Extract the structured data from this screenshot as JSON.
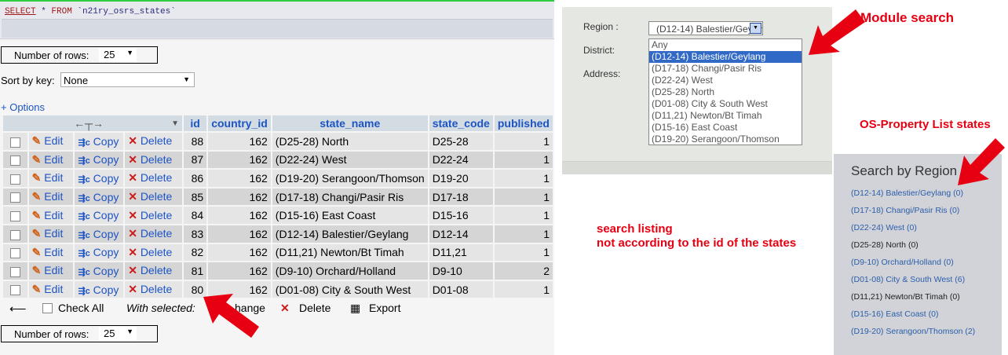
{
  "sql": {
    "kw1": "SELECT",
    "rest1": " * ",
    "kw2": "FROM",
    "rest2": " `n21ry_osrs_states`"
  },
  "num_rows_label": "Number of rows:",
  "num_rows_value": "25",
  "sort_label": "Sort by key:",
  "sort_value": "None",
  "options_link": "+ Options",
  "table": {
    "headers": {
      "id": "id",
      "country_id": "country_id",
      "state_name": "state_name",
      "state_code": "state_code",
      "published": "published"
    },
    "actions": {
      "edit": "Edit",
      "copy": "Copy",
      "delete": "Delete"
    },
    "rows": [
      {
        "id": "88",
        "country_id": "162",
        "state_name": "(D25-28) North",
        "state_code": "D25-28",
        "published": "1"
      },
      {
        "id": "87",
        "country_id": "162",
        "state_name": "(D22-24) West",
        "state_code": "D22-24",
        "published": "1"
      },
      {
        "id": "86",
        "country_id": "162",
        "state_name": "(D19-20) Serangoon/Thomson",
        "state_code": "D19-20",
        "published": "1"
      },
      {
        "id": "85",
        "country_id": "162",
        "state_name": "(D17-18) Changi/Pasir Ris",
        "state_code": "D17-18",
        "published": "1"
      },
      {
        "id": "84",
        "country_id": "162",
        "state_name": "(D15-16) East Coast",
        "state_code": "D15-16",
        "published": "1"
      },
      {
        "id": "83",
        "country_id": "162",
        "state_name": "(D12-14) Balestier/Geylang",
        "state_code": "D12-14",
        "published": "1"
      },
      {
        "id": "82",
        "country_id": "162",
        "state_name": "(D11,21) Newton/Bt Timah",
        "state_code": "D11,21",
        "published": "1"
      },
      {
        "id": "81",
        "country_id": "162",
        "state_name": "(D9-10) Orchard/Holland",
        "state_code": "D9-10",
        "published": "2"
      },
      {
        "id": "80",
        "country_id": "162",
        "state_name": "(D01-08) City & South West",
        "state_code": "D01-08",
        "published": "1"
      }
    ]
  },
  "bottom": {
    "check_all": "Check All",
    "with_selected": "With selected:",
    "change": "hange",
    "delete": "Delete",
    "export": "Export"
  },
  "module": {
    "region_label": "Region :",
    "district_label": "District:",
    "address_label": "Address:",
    "selected_value": "(D12-14) Balestier/Geylang",
    "options": [
      "Any",
      "(D12-14) Balestier/Geylang",
      "(D17-18) Changi/Pasir Ris",
      "(D22-24) West",
      "(D25-28) North",
      "(D01-08) City & South West",
      "(D11,21) Newton/Bt Timah",
      "(D15-16) East Coast",
      "(D19-20) Serangoon/Thomson"
    ]
  },
  "region_panel": {
    "title": "Search by Region",
    "items": [
      {
        "label": "(D12-14) Balestier/Geylang (0)",
        "link": true
      },
      {
        "label": "(D17-18) Changi/Pasir Ris (0)",
        "link": true
      },
      {
        "label": "(D22-24) West (0)",
        "link": true
      },
      {
        "label": "(D25-28) North (0)",
        "link": false
      },
      {
        "label": "(D9-10) Orchard/Holland (0)",
        "link": true
      },
      {
        "label": "(D01-08) City & South West (6)",
        "link": true
      },
      {
        "label": "(D11,21) Newton/Bt Timah (0)",
        "link": false
      },
      {
        "label": "(D15-16) East Coast (0)",
        "link": true
      },
      {
        "label": "(D19-20) Serangoon/Thomson (2)",
        "link": true
      }
    ]
  },
  "annotations": {
    "module_search": "Module search",
    "os_property": "OS-Property List states",
    "listing_line1": "search listing",
    "listing_line2": "not according to the id of the states"
  },
  "colors": {
    "arrow": "#e60012",
    "link": "#1d54c4",
    "header_bg": "#d3dce3"
  }
}
